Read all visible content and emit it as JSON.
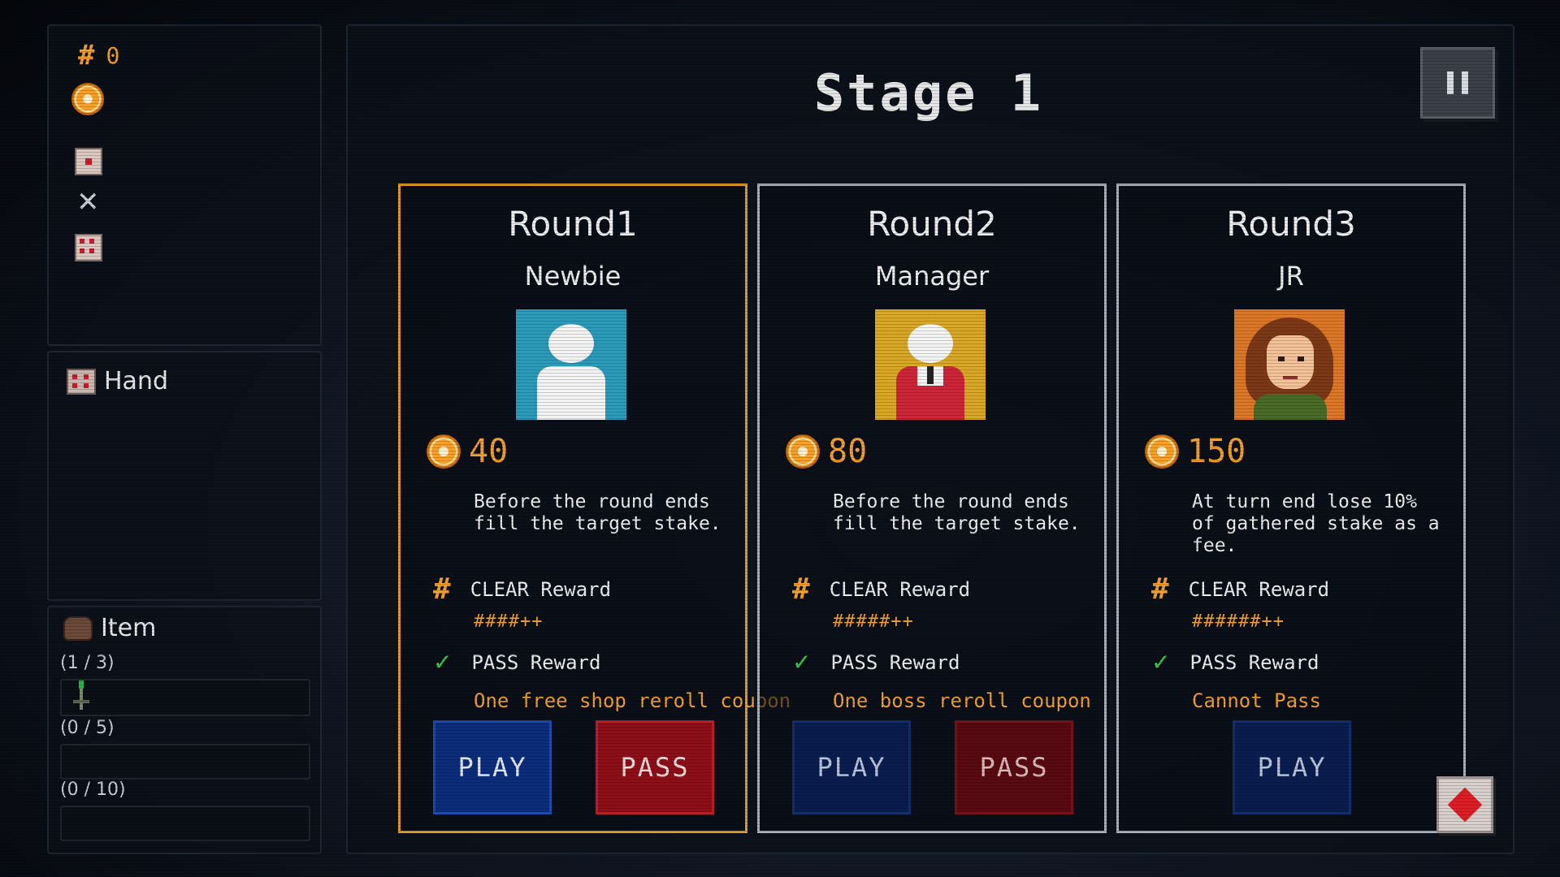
{
  "status": {
    "hash_count": "0",
    "hash_symbol": "#",
    "chip_icon": "chip-icon",
    "icons": [
      "card-single-icon",
      "close-icon",
      "card-multi-icon"
    ]
  },
  "hand": {
    "title": "Hand"
  },
  "item": {
    "title": "Item",
    "slots": [
      {
        "label": "(1 / 3)",
        "filled": 1,
        "capacity": 3
      },
      {
        "label": "(0 / 5)",
        "filled": 0,
        "capacity": 5
      },
      {
        "label": "(0 / 10)",
        "filled": 0,
        "capacity": 10
      }
    ]
  },
  "stage": {
    "title": "Stage 1"
  },
  "rounds": [
    {
      "title": "Round1",
      "opponent": "Newbie",
      "stake": "40",
      "rule": "Before the round ends\nfill the target stake.",
      "clear_label": "CLEAR Reward",
      "clear_value": "####++",
      "pass_label": "PASS Reward",
      "pass_value": "One free shop reroll coupon",
      "play_label": "PLAY",
      "pass_button": "PASS",
      "selected": true
    },
    {
      "title": "Round2",
      "opponent": "Manager",
      "stake": "80",
      "rule": "Before the round ends\nfill the target stake.",
      "clear_label": "CLEAR Reward",
      "clear_value": "#####++",
      "pass_label": "PASS Reward",
      "pass_value": "One boss reroll coupon",
      "play_label": "PLAY",
      "pass_button": "PASS",
      "selected": false
    },
    {
      "title": "Round3",
      "opponent": "JR",
      "stake": "150",
      "rule": "At turn end lose 10%\nof gathered stake as a\nfee.",
      "clear_label": "CLEAR Reward",
      "clear_value": "######++",
      "pass_label": "PASS Reward",
      "pass_value": "Cannot Pass",
      "play_label": "PLAY",
      "selected": false
    }
  ],
  "colors": {
    "accent": "#f0a030",
    "selected_border": "#e09a2a",
    "play": "#0d2d78",
    "pass": "#8a1019",
    "check": "#3cc84a"
  }
}
